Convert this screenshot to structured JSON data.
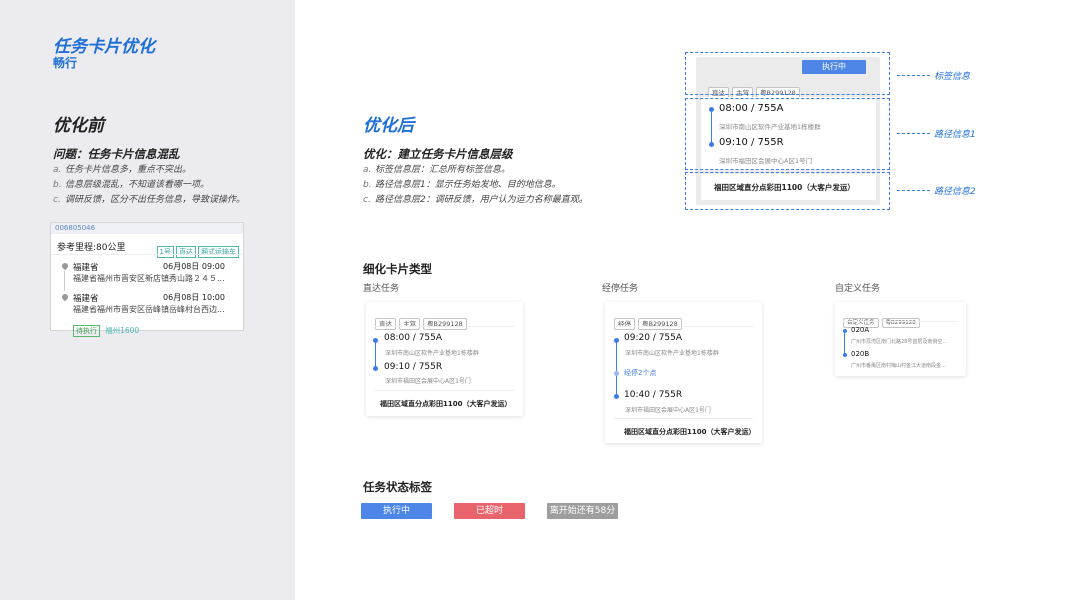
{
  "header": {
    "title": "任务卡片优化",
    "subtitle": "畅行"
  },
  "before": {
    "title": "优化前",
    "problem_title": "问题：任务卡片信息混乱",
    "items": [
      {
        "marker": "a.",
        "text": "任务卡片信息多，重点不突出。"
      },
      {
        "marker": "b.",
        "text": "信息层级混乱，不知道该看哪一项。"
      },
      {
        "marker": "c.",
        "text": "调研反馈，区分不出任务信息，导致误操作。"
      }
    ],
    "old_card": {
      "id": "006805046",
      "mileage": "参考里程:80公里",
      "tags": [
        "1号",
        "直达",
        "厢式运输车"
      ],
      "from_province": "福建省",
      "from_time": "06月08日 09:00",
      "from_addr": "福建省福州市晋安区新店镇秀山路２４５...",
      "to_province": "福建省",
      "to_time": "06月08日 10:00",
      "to_addr": "福建省福州市晋安区岳峰镇岳峰村台西边...",
      "status": "待执行",
      "extra": "福州1600"
    }
  },
  "after": {
    "title": "优化后",
    "opt_title": "优化：建立任务卡片信息层级",
    "items": [
      {
        "marker": "a.",
        "text": "标签信息层：汇总所有标签信息。"
      },
      {
        "marker": "b.",
        "text": "路径信息层1：显示任务始发地、目的地信息。"
      },
      {
        "marker": "c.",
        "text": "路径信息层2：调研反馈，用户认为运力名称最直观。"
      }
    ]
  },
  "demo_card": {
    "status": "执行中",
    "tags": [
      "直达",
      "主驾",
      "粤B299128"
    ],
    "stop1_time": "08:00 / 755A",
    "stop1_addr": "深圳市南山区软件产业基地1栋楼群",
    "stop2_time": "09:10 / 755R",
    "stop2_addr": "深圳市福田区会展中心A区1号门",
    "footer": "福田区域直分点彩田1100（大客户发运）",
    "callouts": [
      "标签信息",
      "路径信息1",
      "路径信息2"
    ]
  },
  "types": {
    "title": "细化卡片类型",
    "direct": {
      "label": "直达任务",
      "tags": [
        "直达",
        "主驾",
        "粤B299128"
      ],
      "stop1_time": "08:00 / 755A",
      "stop1_addr": "深圳市南山区软件产业基地1栋楼群",
      "stop2_time": "09:10 / 755R",
      "stop2_addr": "深圳市福田区会展中心A区1号门",
      "footer": "福田区域直分点彩田1100（大客户发运）"
    },
    "via": {
      "label": "经停任务",
      "tags": [
        "经停",
        "粤B299128"
      ],
      "stop1_time": "09:20 / 755A",
      "stop1_addr": "深圳市南山区软件产业基地1栋楼群",
      "mid": "经停2个点",
      "stop2_time": "10:40 / 755R",
      "stop2_addr": "深圳市福田区会展中心A区1号门",
      "footer": "福田区域直分点彩田1100（大客户发运）"
    },
    "custom": {
      "label": "自定义任务",
      "tags": [
        "自定义任务",
        "粤B299128"
      ],
      "stop1_time": "020A",
      "stop1_addr": "广州市荔湾区南门北路28号首层及南侧空...",
      "stop2_time": "020B",
      "stop2_addr": "广州市番禺区南村梅山村金江大道南段金..."
    }
  },
  "status_tags": {
    "title": "任务状态标签",
    "items": [
      {
        "label": "执行中",
        "color": "#4d86e6"
      },
      {
        "label": "已超时",
        "color": "#e8636b"
      },
      {
        "label": "离开始还有58分",
        "color": "#9e9e9e"
      }
    ]
  },
  "colors": {
    "accent": "#1f6fd6",
    "sidebar_bg": "#ececf0"
  }
}
